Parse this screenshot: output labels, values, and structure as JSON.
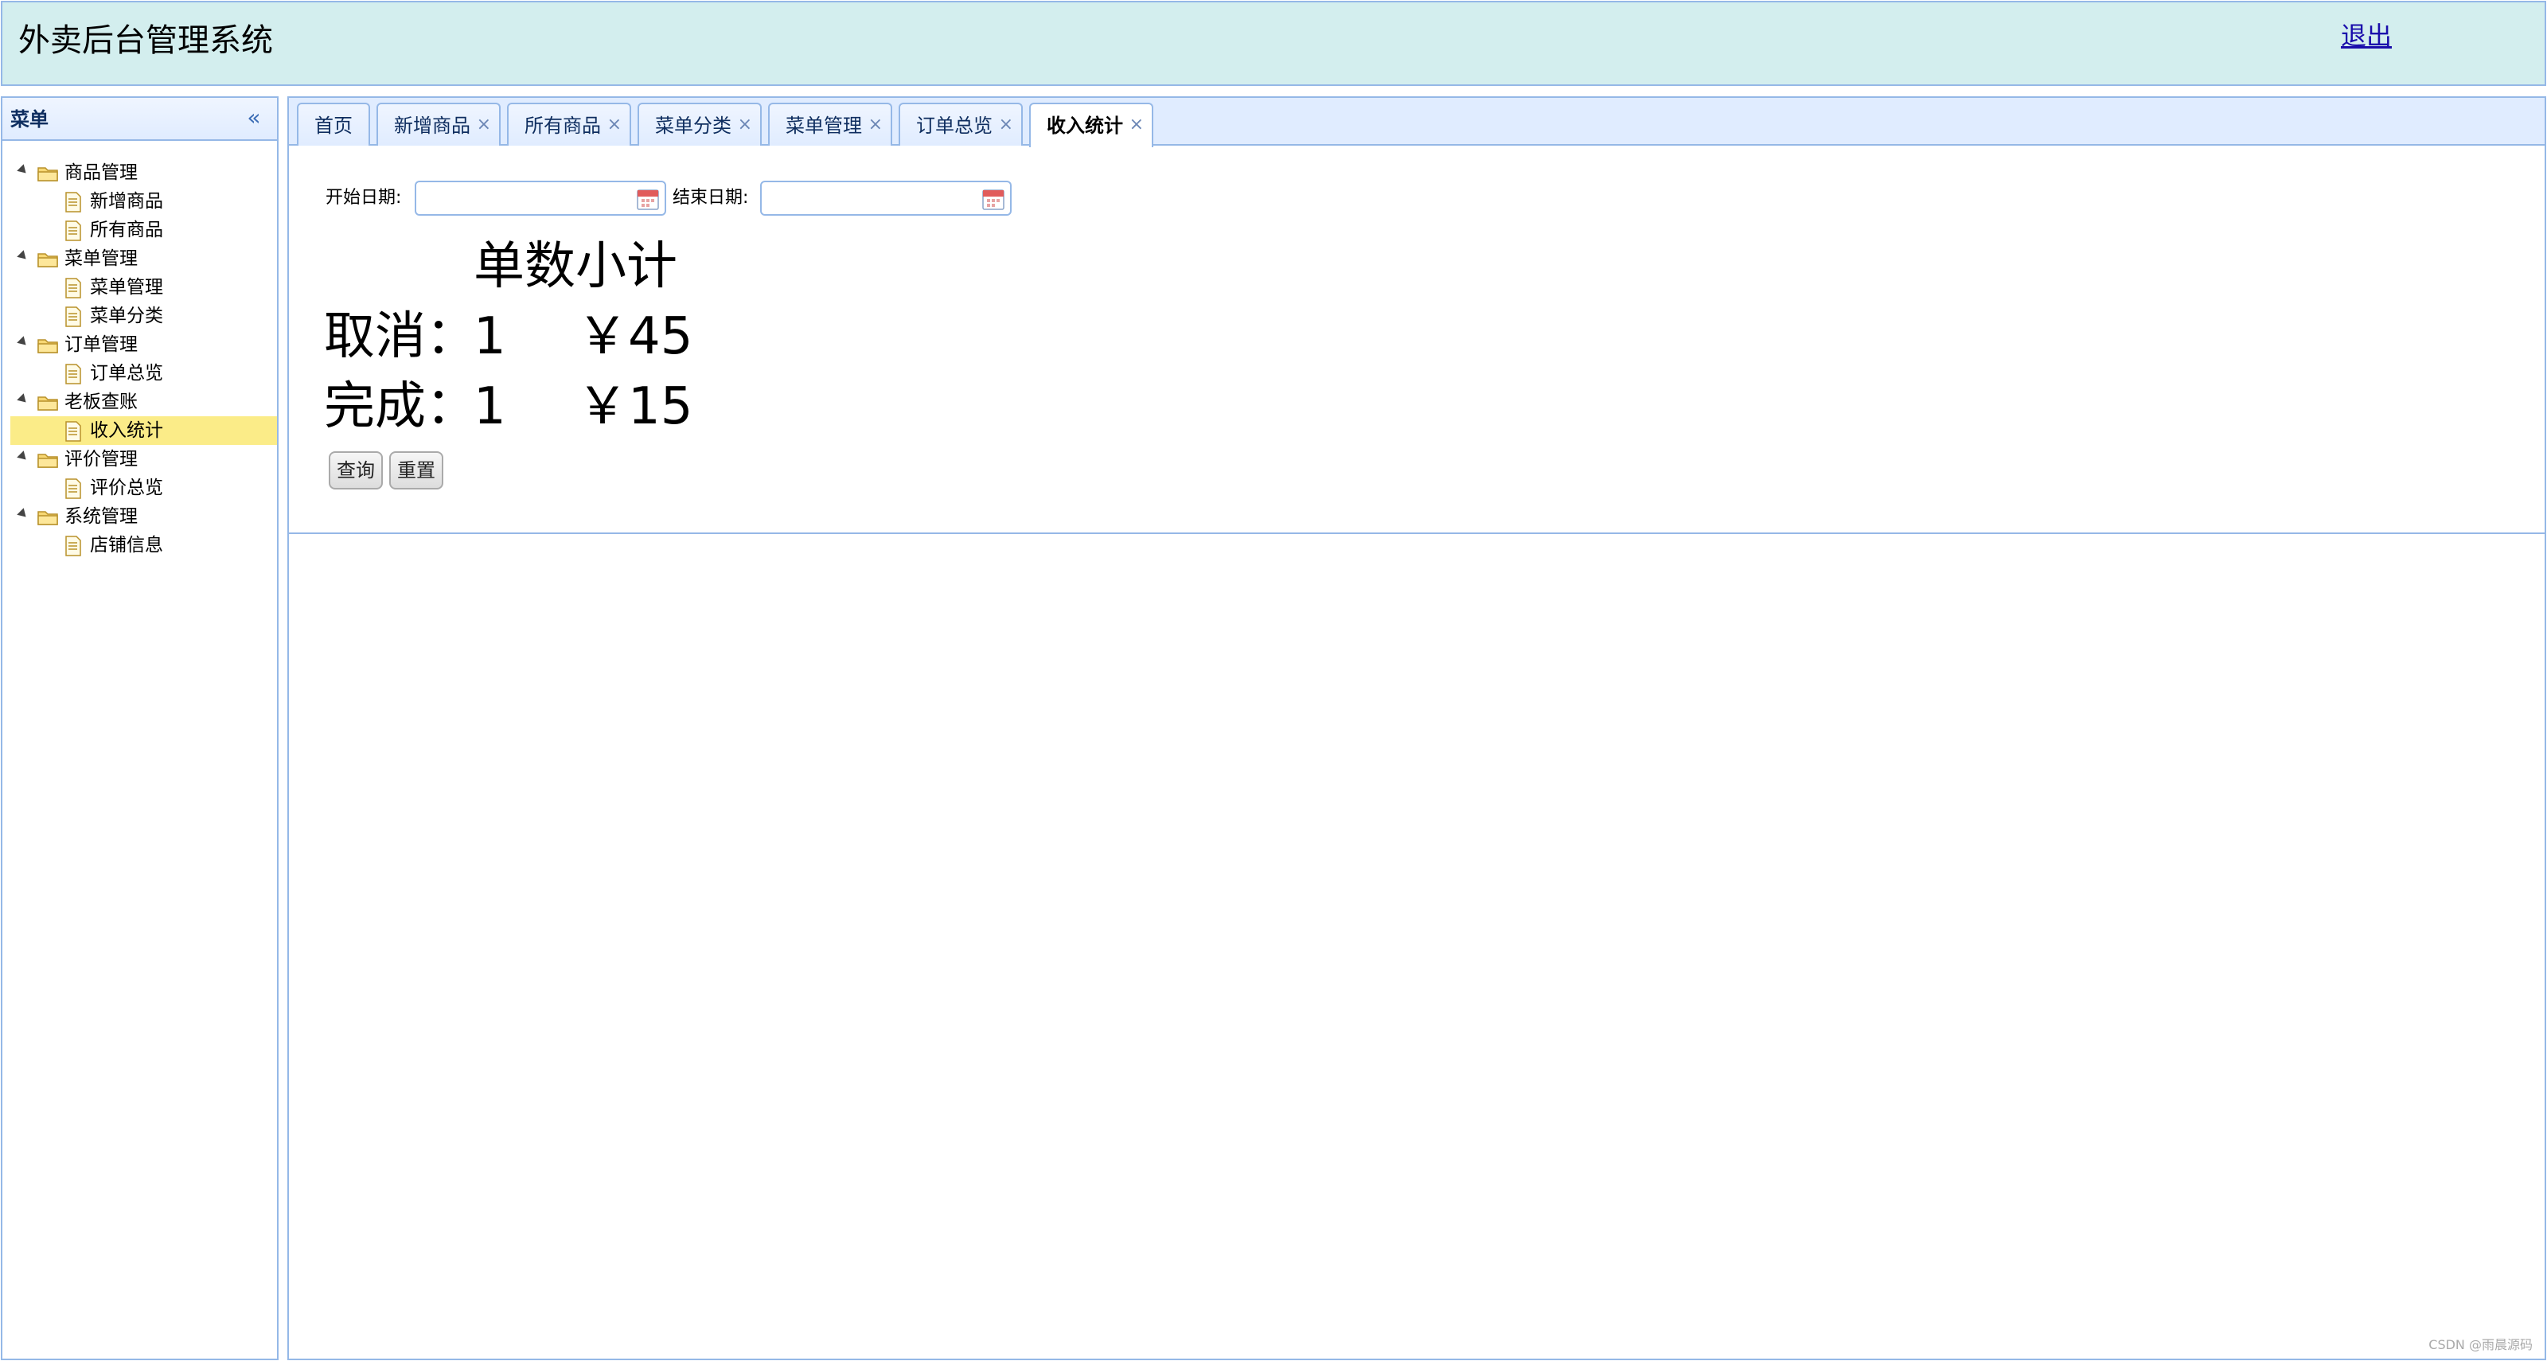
{
  "header": {
    "title": "外卖后台管理系统",
    "logout_label": "退出"
  },
  "menu": {
    "title": "菜单",
    "collapse_icon": "double-chevron-left-icon",
    "groups": [
      {
        "label": "商品管理",
        "children": [
          "新增商品",
          "所有商品"
        ]
      },
      {
        "label": "菜单管理",
        "children": [
          "菜单管理",
          "菜单分类"
        ]
      },
      {
        "label": "订单管理",
        "children": [
          "订单总览"
        ]
      },
      {
        "label": "老板查账",
        "children": [
          "收入统计"
        ]
      },
      {
        "label": "评价管理",
        "children": [
          "评价总览"
        ]
      },
      {
        "label": "系统管理",
        "children": [
          "店铺信息"
        ]
      }
    ],
    "selected_item": "收入统计"
  },
  "tabs": [
    {
      "label": "首页",
      "closable": false,
      "active": false
    },
    {
      "label": "新增商品",
      "closable": true,
      "active": false
    },
    {
      "label": "所有商品",
      "closable": true,
      "active": false
    },
    {
      "label": "菜单分类",
      "closable": true,
      "active": false
    },
    {
      "label": "菜单管理",
      "closable": true,
      "active": false
    },
    {
      "label": "订单总览",
      "closable": true,
      "active": false
    },
    {
      "label": "收入统计",
      "closable": true,
      "active": true
    }
  ],
  "tab_close_glyph": "×",
  "filters": {
    "start_label": "开始日期:",
    "start_value": "",
    "end_label": "结束日期:",
    "end_value": ""
  },
  "stats": {
    "header": "单数小计",
    "rows": [
      {
        "label": "取消：",
        "count": "1",
        "amount": "￥45"
      },
      {
        "label": "完成：",
        "count": "1",
        "amount": "￥15"
      }
    ]
  },
  "buttons": {
    "query": "查询",
    "reset": "重置"
  },
  "watermark": "CSDN @雨晨源码",
  "colors": {
    "header_bg": "#d3eeee",
    "border": "#95b8e7",
    "selected_bg": "#fbec88",
    "link": "#1a0dab"
  }
}
